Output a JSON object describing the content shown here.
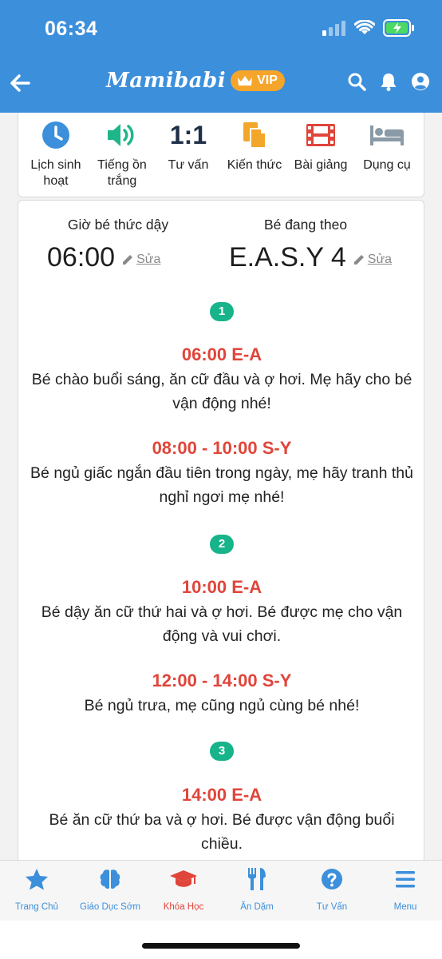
{
  "status_bar": {
    "time": "06:34"
  },
  "header": {
    "brand": "Mamibabi",
    "vip": "VIP"
  },
  "categories": [
    {
      "label": "Lịch sinh hoạt",
      "icon": "clock-icon"
    },
    {
      "label": "Tiếng ồn trắng",
      "icon": "speaker-icon"
    },
    {
      "label": "Tư vấn",
      "badge": "1:1",
      "icon": "one-on-one-icon"
    },
    {
      "label": "Kiến thức",
      "icon": "documents-icon"
    },
    {
      "label": "Bài giảng",
      "icon": "film-icon"
    },
    {
      "label": "Dụng cụ",
      "icon": "bed-icon"
    }
  ],
  "schedule": {
    "wake_caption": "Giờ bé thức dậy",
    "wake_time": "06:00",
    "plan_caption": "Bé đang theo",
    "plan_name": "E.A.S.Y 4",
    "edit_label": "Sửa",
    "steps": [
      {
        "number": "1"
      },
      {
        "number": "2"
      },
      {
        "number": "3"
      }
    ],
    "entries": [
      {
        "title": "06:00 E-A",
        "desc": "Bé chào buổi sáng, ăn cữ đầu và ợ hơi. Mẹ hãy cho bé vận động nhé!"
      },
      {
        "title": "08:00 - 10:00 S-Y",
        "desc": "Bé ngủ giấc ngắn đầu tiên trong ngày, mẹ hãy tranh thủ nghỉ ngơi mẹ nhé!"
      },
      {
        "title": "10:00 E-A",
        "desc": "Bé dậy ăn cữ thứ hai và ợ hơi. Bé được mẹ cho vận động và vui chơi."
      },
      {
        "title": "12:00 - 14:00 S-Y",
        "desc": "Bé ngủ trưa, mẹ cũng ngủ cùng bé nhé!"
      },
      {
        "title": "14:00 E-A",
        "desc": "Bé ăn cữ thứ ba và ợ hơi. Bé được vận động buổi chiều."
      }
    ]
  },
  "bottom_nav": [
    {
      "label": "Trang Chủ",
      "icon": "star-icon"
    },
    {
      "label": "Giáo Dục Sớm",
      "icon": "brain-icon"
    },
    {
      "label": "Khóa Học",
      "icon": "graduation-cap-icon",
      "active": true
    },
    {
      "label": "Ăn Dặm",
      "icon": "utensils-icon"
    },
    {
      "label": "Tư Vấn",
      "icon": "question-icon"
    },
    {
      "label": "Menu",
      "icon": "menu-icon"
    }
  ],
  "colors": {
    "primary": "#3c8fdb",
    "accent": "#e0453a",
    "vip": "#f5a52a",
    "step": "#17b38a"
  }
}
